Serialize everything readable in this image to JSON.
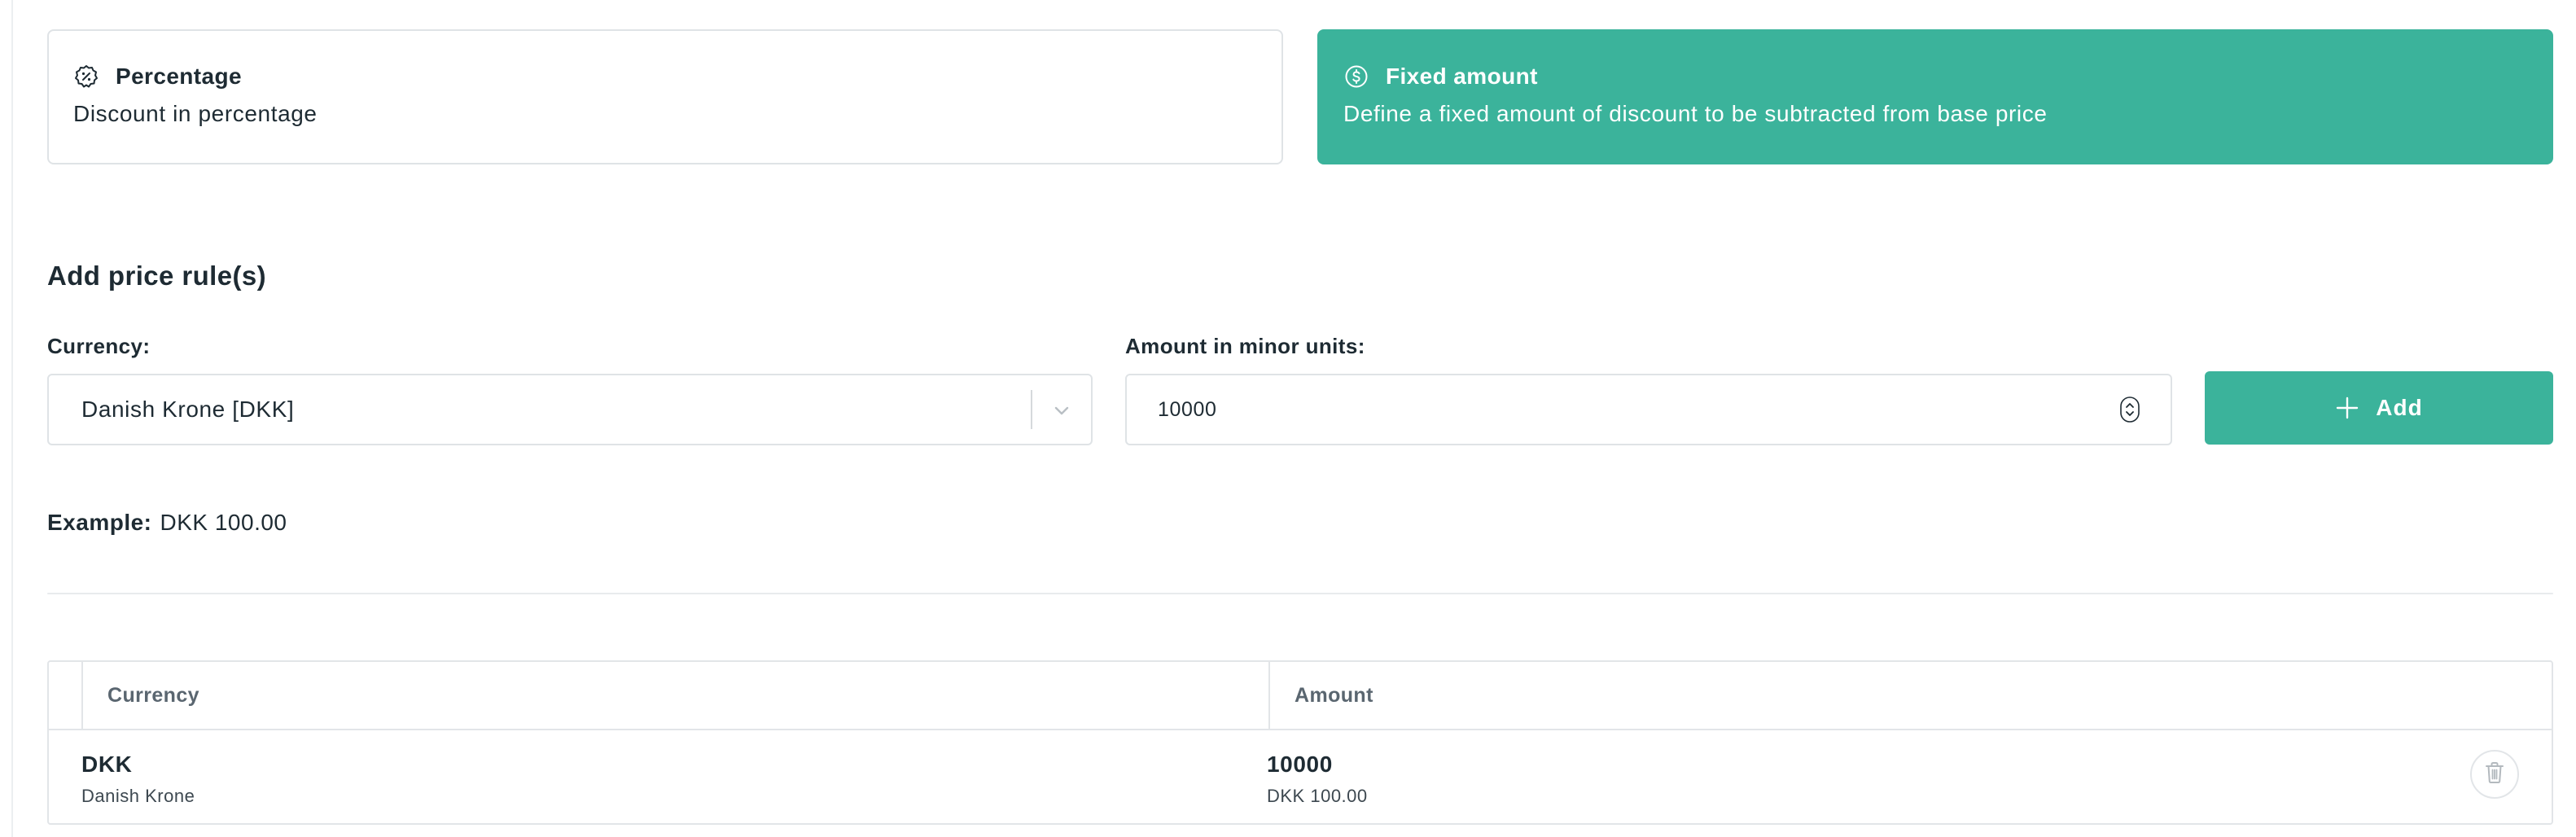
{
  "discount_types": {
    "percentage": {
      "title": "Percentage",
      "description": "Discount in percentage",
      "icon": "percent-badge-icon",
      "selected": false
    },
    "fixed": {
      "title": "Fixed amount",
      "description": "Define a fixed amount of discount to be subtracted from base price",
      "icon": "dollar-coin-icon",
      "selected": true
    }
  },
  "section": {
    "title": "Add price rule(s)"
  },
  "form": {
    "currency_label": "Currency:",
    "currency_value": "Danish Krone [DKK]",
    "amount_label": "Amount in minor units:",
    "amount_value": "10000",
    "add_label": "Add"
  },
  "example": {
    "label": "Example:",
    "value": "DKK 100.00"
  },
  "table": {
    "headers": {
      "currency": "Currency",
      "amount": "Amount"
    },
    "rows": [
      {
        "currency_code": "DKK",
        "currency_name": "Danish Krone",
        "amount": "10000",
        "formatted": "DKK 100.00"
      }
    ]
  },
  "colors": {
    "accent": "#3bb39b",
    "border": "#dfe3e6",
    "text": "#1e2b33",
    "muted": "#5a6670"
  }
}
